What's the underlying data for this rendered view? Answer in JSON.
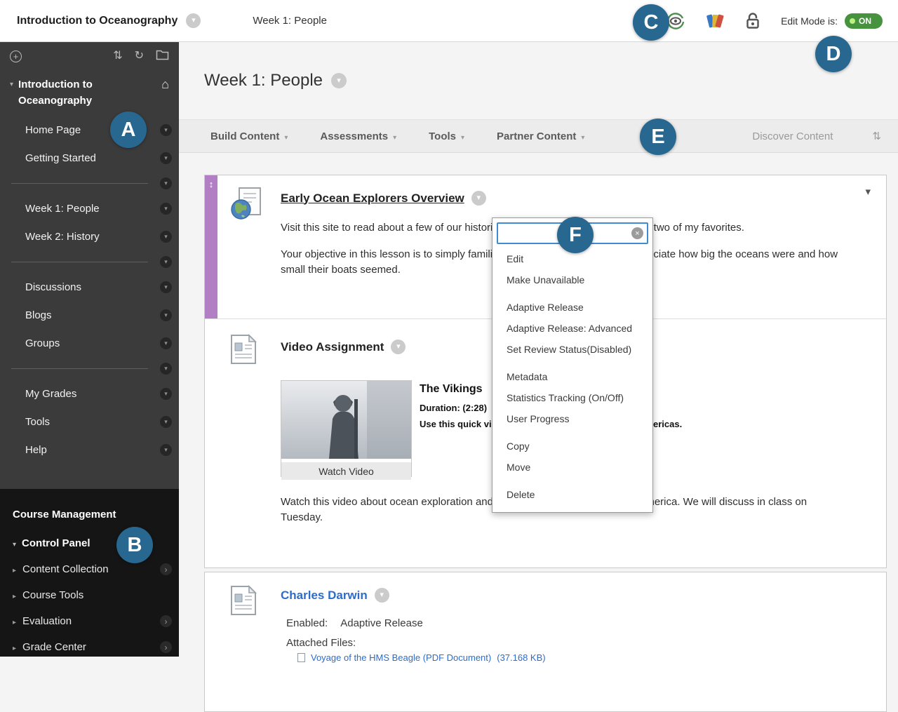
{
  "header": {
    "course_title": "Introduction to Oceanography",
    "breadcrumb": "Week 1: People",
    "edit_mode_label": "Edit Mode is:",
    "edit_mode_value": "ON"
  },
  "callouts": {
    "a": "A",
    "b": "B",
    "c": "C",
    "d": "D",
    "e": "E",
    "f": "F"
  },
  "sidebar": {
    "course_title_line1": "Introduction to",
    "course_title_line2": "Oceanography",
    "groups": [
      [
        "Home Page",
        "Getting Started"
      ],
      [
        "Week 1: People",
        "Week 2: History"
      ],
      [
        "Discussions",
        "Blogs",
        "Groups"
      ],
      [
        "My Grades",
        "Tools",
        "Help"
      ]
    ],
    "course_management": {
      "title": "Course Management",
      "control_panel": "Control Panel",
      "items": [
        {
          "label": "Content Collection",
          "arrow": "›"
        },
        {
          "label": "Course Tools",
          "arrow": ""
        },
        {
          "label": "Evaluation",
          "arrow": "›"
        },
        {
          "label": "Grade Center",
          "arrow": "›"
        }
      ]
    }
  },
  "main": {
    "page_title": "Week 1: People",
    "action_bar": {
      "buttons": [
        "Build Content",
        "Assessments",
        "Tools",
        "Partner Content"
      ],
      "discover_label": "Discover Content"
    },
    "item1": {
      "title": "Early Ocean Explorers Overview",
      "p1": "Visit this site to read about a few of our historical ocean explorers. I wrote about two of my favorites.",
      "p2": "Your objective in this lesson is to simply familiarize yourself with them and appreciate how big the oceans were and how small their boats seemed."
    },
    "item2": {
      "title": "Video Assignment",
      "video_title": "The Vikings",
      "duration": "Duration: (2:28)",
      "summary": "Use this quick video to see how Vikings got to the Americas.",
      "watch_button": "Watch Video",
      "description": "Watch this video about ocean exploration and learn how the Vikings came to America. We will discuss in class on Tuesday."
    },
    "item3": {
      "title": "Charles Darwin",
      "enabled_label": "Enabled:",
      "enabled_value": "Adaptive Release",
      "attached_label": "Attached Files:",
      "file_name": "Voyage of the HMS Beagle (PDF Document)",
      "file_size": "(37.168 KB)"
    }
  },
  "context_menu": {
    "search_placeholder": "",
    "groups": [
      [
        "Edit",
        "Make Unavailable"
      ],
      [
        "Adaptive Release",
        "Adaptive Release: Advanced",
        "Set Review Status(Disabled)"
      ],
      [
        "Metadata",
        "Statistics Tracking (On/Off)",
        "User Progress"
      ],
      [
        "Copy",
        "Move"
      ],
      [
        "Delete"
      ]
    ]
  }
}
